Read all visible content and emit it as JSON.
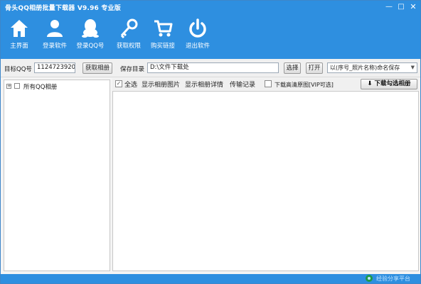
{
  "window": {
    "title": "骨头QQ相册批量下载器 V9.96 专业版",
    "controls": {
      "minimize": "—",
      "maximize": "□",
      "close": "✕"
    }
  },
  "toolbar": {
    "items": [
      {
        "label": "主界面",
        "icon": "home-icon"
      },
      {
        "label": "登录软件",
        "icon": "user-icon"
      },
      {
        "label": "登录QQ号",
        "icon": "qq-penguin-icon"
      },
      {
        "label": "获取权限",
        "icon": "key-icon"
      },
      {
        "label": "购买链接",
        "icon": "cart-icon"
      },
      {
        "label": "退出软件",
        "icon": "power-icon"
      }
    ]
  },
  "controls": {
    "target_label": "目标QQ号",
    "target_value": "1124723920",
    "fetch_album_button": "获取相册",
    "save_dir_label": "保存目录",
    "save_dir_value": "D:\\文件下载处",
    "select_button": "选择",
    "open_button": "打开",
    "naming_option": "以(序号_照片名称)命名保存"
  },
  "tree": {
    "expander": "+",
    "root_label": "所有QQ相册"
  },
  "right_panel": {
    "select_all": "全选",
    "show_album_images": "显示相册图片",
    "show_album_details": "显示相册详情",
    "transfer_log": "传输记录",
    "hd_download": "下载高清原图[VIP可选]",
    "download_selected_button": "下载勾选相册"
  },
  "statusbar": {
    "watermark": "经验分享平台"
  },
  "colors": {
    "header_blue": "#2e8fe0",
    "panel_bg": "#f0f0f0"
  }
}
